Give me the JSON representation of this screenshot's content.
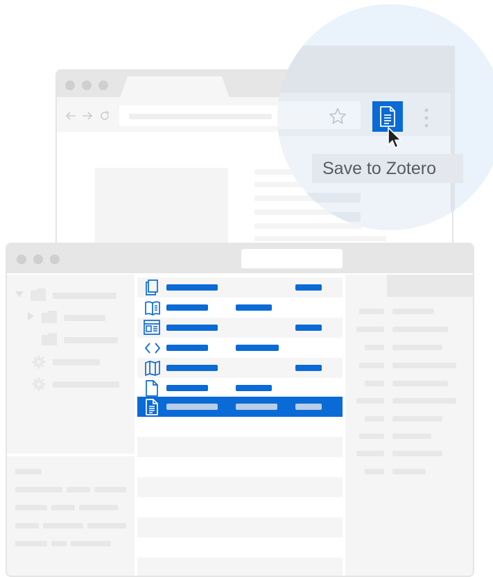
{
  "browser": {
    "toolbar_icons": [
      "back-arrow-icon",
      "forward-arrow-icon",
      "reload-icon",
      "star-icon",
      "zotero-save-icon",
      "more-vert-icon"
    ],
    "zotero_button_label": "Save to Zotero"
  },
  "zotero": {
    "item_icons": [
      "book-section-icon",
      "book-icon",
      "webpage-icon",
      "code-icon",
      "map-icon",
      "document-icon",
      "journal-article-icon"
    ],
    "selected_row_index": 6
  },
  "colors": {
    "accent": "#0a6ad6",
    "zoom_circle": "#eaf2fb",
    "tooltip_bg": "#e4e8ed",
    "placeholder": "#efefef",
    "window_chrome": "#e6e6e6"
  }
}
